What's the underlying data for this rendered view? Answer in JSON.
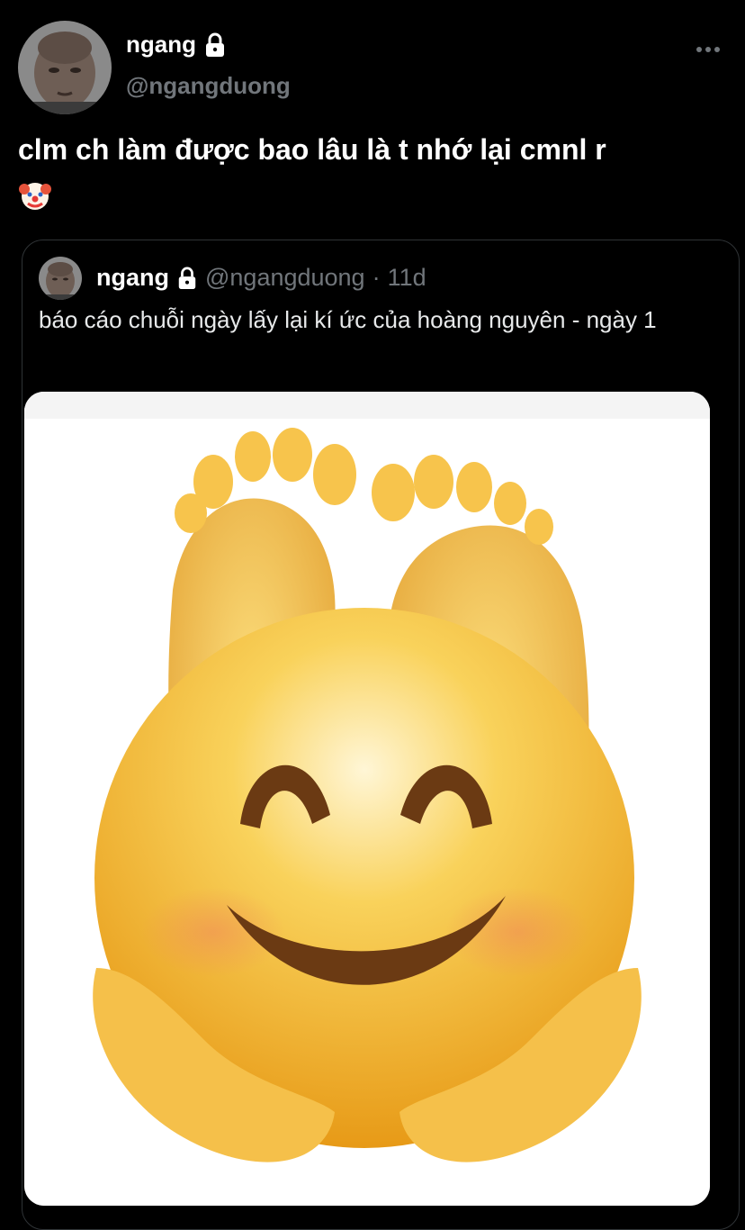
{
  "tweet": {
    "display_name": "ngang",
    "handle": "@ngangduong",
    "text": "clm ch làm được bao lâu là t nhớ lại cmnl r",
    "avatar_icon": "avatar-photo",
    "lock_icon": "lock-icon",
    "more_icon": "more-horizontal-icon",
    "emoji_icon": "clown-face-icon"
  },
  "quoted": {
    "display_name": "ngang",
    "handle": "@ngangduong",
    "separator": "·",
    "time": "11d",
    "text": "báo cáo chuỗi ngày lấy lại kí ức của hoàng nguyên - ngày 1",
    "media_icon": "smiling-emoji-with-feet-image"
  },
  "colors": {
    "background": "#000000",
    "text_primary": "#ffffff",
    "text_secondary": "#71767b",
    "border": "#2f3336",
    "emoji_yellow": "#f5b52e"
  }
}
